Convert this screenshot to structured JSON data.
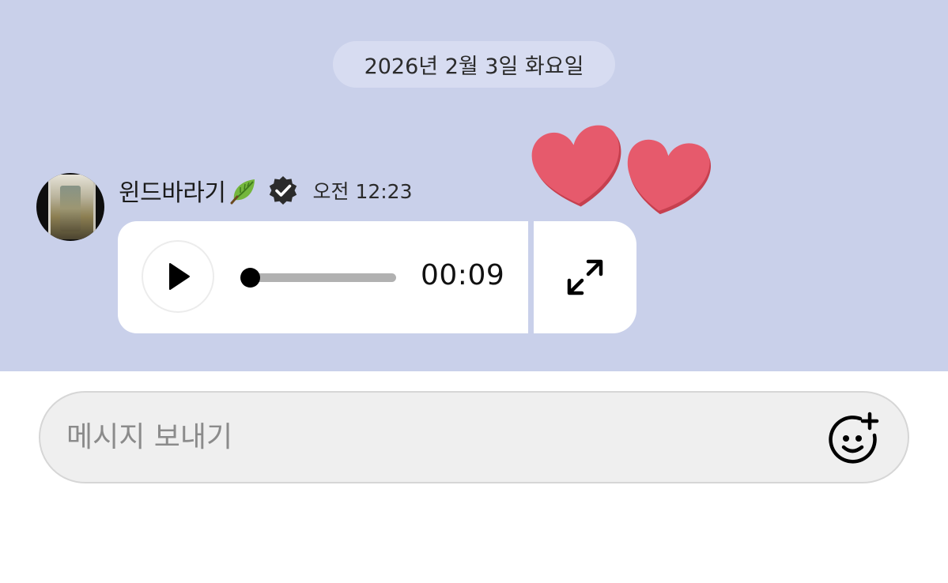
{
  "date_separator": "2026년 2월 3일 화요일",
  "message": {
    "sender": "윈드바라기",
    "sender_emoji": "leaf-icon",
    "verified_icon": "verified-badge-icon",
    "time": "오전 12:23",
    "audio": {
      "duration": "00:09",
      "progress": 0,
      "play_icon": "play-icon",
      "expand_icon": "expand-icon"
    },
    "reaction": "heart-icon"
  },
  "composer": {
    "placeholder": "메시지 보내기",
    "emoji_icon": "add-emoji-icon"
  },
  "colors": {
    "chat_background": "#c9d0ea",
    "date_pill": "#d7dcf1",
    "bubble": "#ffffff",
    "heart": "#e65a6c",
    "composer_background": "#efefef"
  }
}
